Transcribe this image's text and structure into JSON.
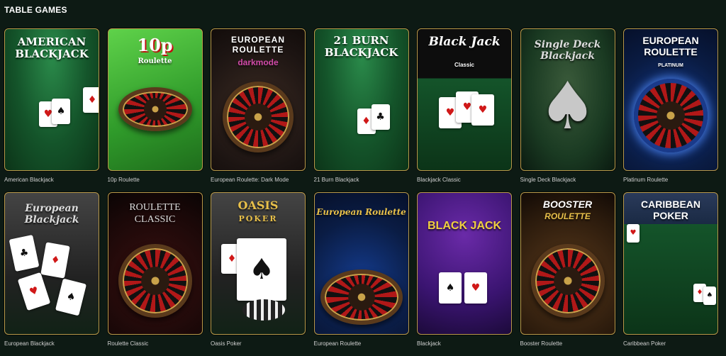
{
  "section": {
    "title": "TABLE GAMES"
  },
  "games": [
    {
      "label": "American Blackjack",
      "art_title": "AMERICAN BLACKJACK"
    },
    {
      "label": "10p Roulette",
      "art_title": "10p",
      "art_sub": "Roulette"
    },
    {
      "label": "European Roulette: Dark Mode",
      "art_title": "EUROPEAN ROULETTE",
      "art_sub": "darkmode"
    },
    {
      "label": "21 Burn Blackjack",
      "art_title": "21 BURN BLACKJACK"
    },
    {
      "label": "Blackjack Classic",
      "art_title": "Black Jack",
      "art_sub": "Classic"
    },
    {
      "label": "Single Deck Blackjack",
      "art_title": "Single Deck Blackjack"
    },
    {
      "label": "Platinum Roulette",
      "art_title": "EUROPEAN ROULETTE",
      "art_sub": "PLATINUM"
    },
    {
      "label": "European Blackjack",
      "art_title": "European Blackjack"
    },
    {
      "label": "Roulette Classic",
      "art_title": "ROULETTE CLASSIC"
    },
    {
      "label": "Oasis Poker",
      "art_title": "OASIS",
      "art_sub": "POKER"
    },
    {
      "label": "European Roulette",
      "art_title": "European Roulette"
    },
    {
      "label": "Blackjack",
      "art_title": "BLACK JACK"
    },
    {
      "label": "Booster Roulette",
      "art_title": "BOOSTER",
      "art_sub": "ROULETTE"
    },
    {
      "label": "Caribbean Poker",
      "art_title": "CARIBBEAN POKER"
    }
  ]
}
